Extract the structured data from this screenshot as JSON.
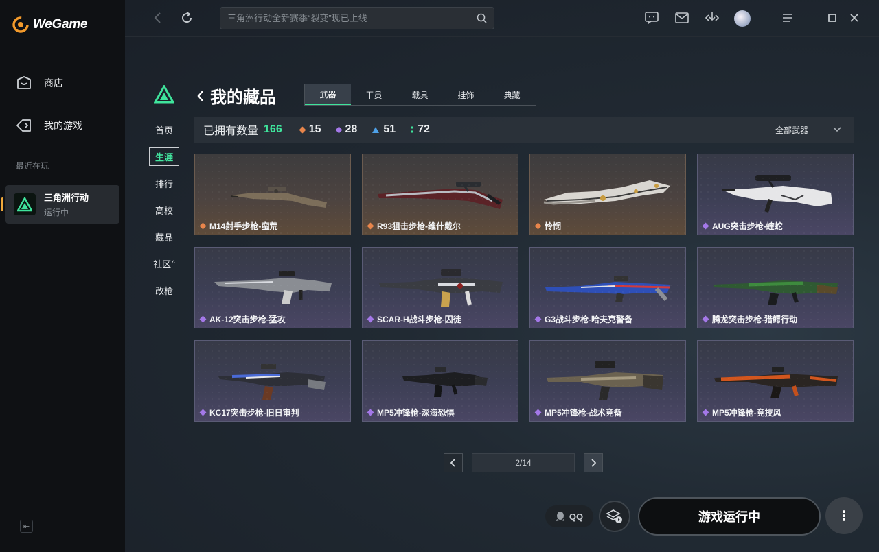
{
  "app": {
    "logo_text": "WeGame"
  },
  "sidebar": {
    "nav": [
      {
        "label": "商店",
        "icon": "shop-bag-icon"
      },
      {
        "label": "我的游戏",
        "icon": "gamepad-icon"
      }
    ],
    "recent_label": "最近在玩",
    "recent_game": {
      "name": "三角洲行动",
      "status": "运行中"
    }
  },
  "topbar": {
    "search_placeholder": "三角洲行动全新赛季“裂变”现已上线",
    "icons": [
      "back-arrow-icon",
      "refresh-icon",
      "search-icon",
      "chat-icon",
      "mail-icon",
      "download-icon",
      "avatar",
      "menu-icon",
      "maximize-icon",
      "close-icon"
    ]
  },
  "game_nav": {
    "items": [
      "首页",
      "生涯",
      "排行",
      "高校",
      "藏品",
      "社区",
      "改枪"
    ],
    "active": "生涯",
    "community_arrow": "^"
  },
  "page": {
    "title": "我的藏品",
    "tabs": [
      "武器",
      "干员",
      "载具",
      "挂饰",
      "典藏"
    ],
    "active_tab": "武器",
    "owned_label": "已拥有数量",
    "owned_total": "166",
    "stats": [
      {
        "count": "15",
        "color": "#e8854b"
      },
      {
        "count": "28",
        "color": "#a478e8"
      },
      {
        "count": "51",
        "color": "#4ea1e8"
      },
      {
        "count": "72",
        "color": "#3fe49c"
      }
    ],
    "filter_label": "全部武器"
  },
  "items": [
    {
      "name": "M14射手步枪-蛮荒",
      "rarity": "gold"
    },
    {
      "name": "R93狙击步枪-维什戴尔",
      "rarity": "gold"
    },
    {
      "name": "怜悯",
      "rarity": "gold"
    },
    {
      "name": "AUG突击步枪-蝰蛇",
      "rarity": "purple"
    },
    {
      "name": "AK-12突击步枪-猛攻",
      "rarity": "purple"
    },
    {
      "name": "SCAR-H战斗步枪-囚徒",
      "rarity": "purple"
    },
    {
      "name": "G3战斗步枪-哈夫克警备",
      "rarity": "purple"
    },
    {
      "name": "腾龙突击步枪-猎鳄行动",
      "rarity": "purple"
    },
    {
      "name": "KC17突击步枪-旧日审判",
      "rarity": "purple"
    },
    {
      "name": "MP5冲锋枪-深海恐惧",
      "rarity": "purple"
    },
    {
      "name": "MP5冲锋枪-战术竞备",
      "rarity": "purple"
    },
    {
      "name": "MP5冲锋枪-竞技风",
      "rarity": "purple"
    }
  ],
  "pager": {
    "text": "2/14",
    "prev": "<",
    "next": ">"
  },
  "bottom": {
    "qq_label": "QQ",
    "play_label": "游戏运行中",
    "more_label": "⋮"
  },
  "colors": {
    "accent_green": "#3fe49c",
    "gold_rarity": "#e8854b",
    "purple_rarity": "#a478e8"
  }
}
